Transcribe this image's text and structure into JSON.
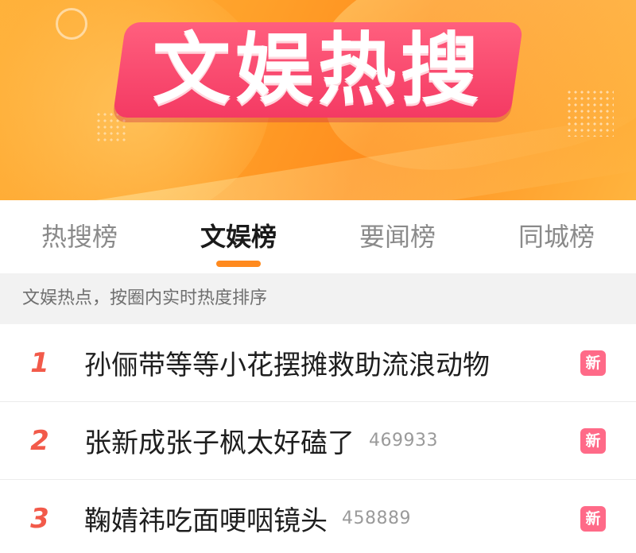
{
  "banner": {
    "title": "文娱热搜"
  },
  "tabs": [
    {
      "label": "热搜榜",
      "active": false
    },
    {
      "label": "文娱榜",
      "active": true
    },
    {
      "label": "要闻榜",
      "active": false
    },
    {
      "label": "同城榜",
      "active": false
    }
  ],
  "subheader": {
    "text": "文娱热点，按圈内实时热度排序"
  },
  "list": [
    {
      "rank": "1",
      "title": "孙俪带等等小花摆摊救助流浪动物",
      "count": "",
      "badge": "新"
    },
    {
      "rank": "2",
      "title": "张新成张子枫太好磕了",
      "count": "469933",
      "badge": "新"
    },
    {
      "rank": "3",
      "title": "鞠婧祎吃面哽咽镜头",
      "count": "458889",
      "badge": "新"
    }
  ],
  "colors": {
    "accent": "#ff8a1e",
    "rank": "#f25a4a",
    "badge": "#ff6a88",
    "banner_title_bg": "#f43a63"
  }
}
